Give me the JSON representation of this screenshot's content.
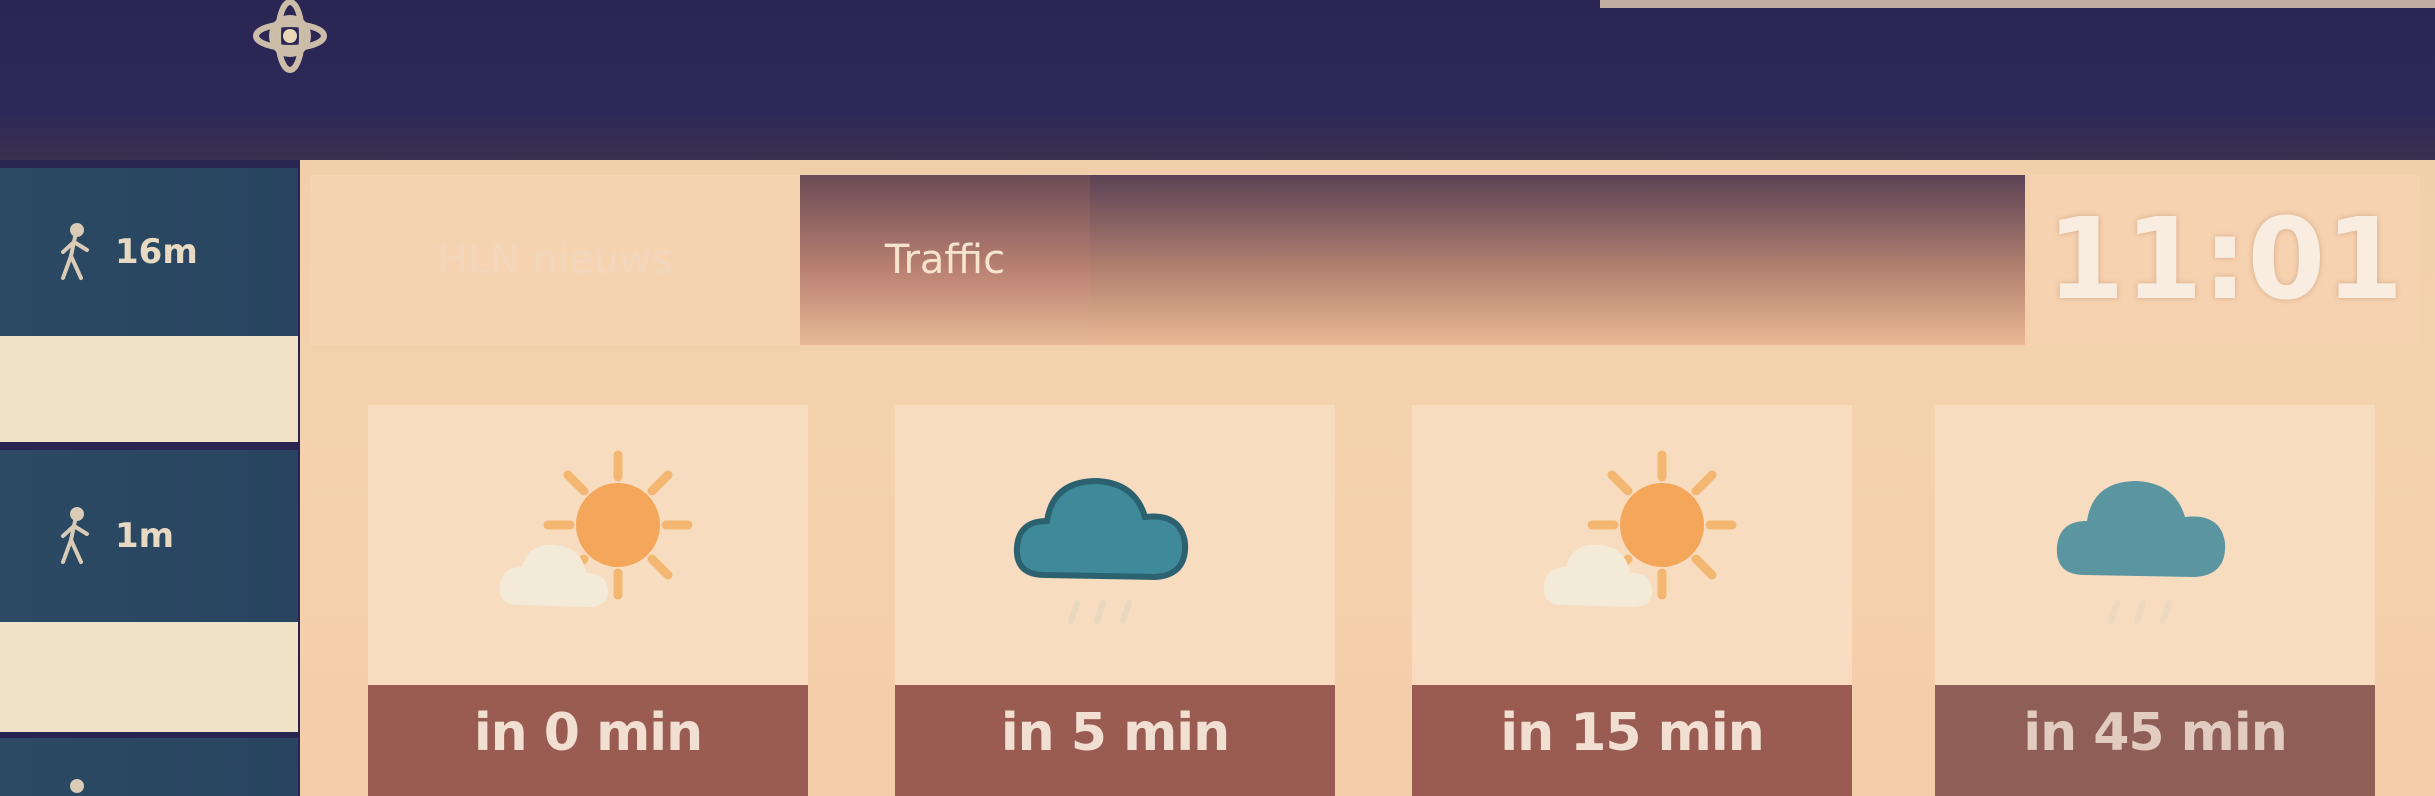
{
  "topbar": {
    "logo_icon": "gear-atom-icon"
  },
  "sidebar": {
    "items": [
      {
        "icon": "walking-person-icon",
        "time": "16m"
      },
      {
        "icon": "walking-person-icon",
        "time": "1m"
      },
      {
        "icon": "walking-person-icon",
        "time": ""
      }
    ]
  },
  "tabs": [
    {
      "label": "HLN nieuws"
    },
    {
      "label": "Traffic"
    }
  ],
  "clock": {
    "time": "11:01"
  },
  "forecast": [
    {
      "icon": "sun-cloud-icon",
      "label": "in 0 min"
    },
    {
      "icon": "rain-cloud-icon",
      "label": "in 5 min"
    },
    {
      "icon": "sun-cloud-icon",
      "label": "in 15 min"
    },
    {
      "icon": "rain-cloud-icon",
      "label": "in 45 min"
    }
  ],
  "colors": {
    "topbar": "#2b2554",
    "sidebar_item": "#2c4a64",
    "panel": "#f2cfab",
    "card_footer": "#9a5c52",
    "sun": "#f4a65a",
    "rain_cloud": "#3f8a9a"
  }
}
